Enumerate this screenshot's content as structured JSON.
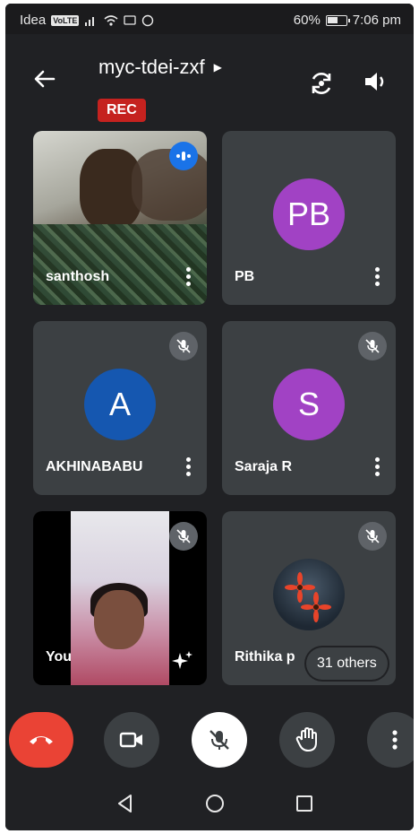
{
  "status_bar": {
    "carrier": "Idea",
    "volte": "VoLTE",
    "battery": "60%",
    "battery_level": 0.6,
    "time": "7:06 pm"
  },
  "header": {
    "meeting_code": "myc-tdei-zxf",
    "rec_label": "REC"
  },
  "participants": [
    {
      "name": "santhosh",
      "kind": "video",
      "state": "speaking"
    },
    {
      "name": "PB",
      "initials": "PB",
      "avatar_color": "#a142c4",
      "kind": "avatar"
    },
    {
      "name": "AKHINABABU",
      "initials": "A",
      "avatar_color": "#1557b0",
      "kind": "avatar",
      "state": "muted"
    },
    {
      "name": "Saraja R",
      "initials": "S",
      "avatar_color": "#a142c4",
      "kind": "avatar",
      "state": "muted"
    },
    {
      "name": "You",
      "kind": "video",
      "state": "muted"
    },
    {
      "name": "Rithika p",
      "kind": "photo",
      "state": "muted"
    }
  ],
  "others_label": "31 others",
  "colors": {
    "background": "#202124",
    "tile": "#3c4043",
    "end_call": "#ea4335",
    "rec": "#c5221f",
    "speaking": "#1a73e8"
  },
  "controls": [
    "end-call-icon",
    "camera-icon",
    "mic-off-icon",
    "raise-hand-icon",
    "more-vert-icon"
  ],
  "nav": [
    "back-triangle-icon",
    "home-circle-icon",
    "recents-square-icon"
  ]
}
